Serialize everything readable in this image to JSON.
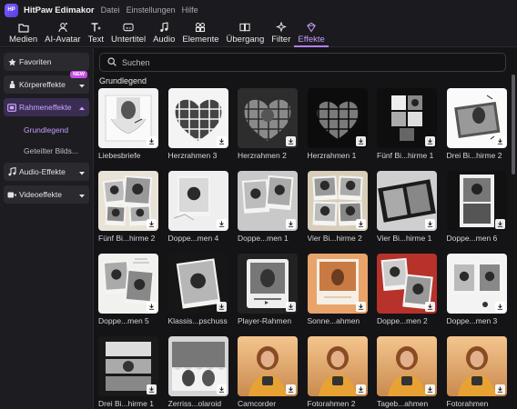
{
  "app": {
    "logo_text": "HP",
    "title": "HitPaw Edimakor",
    "menu": [
      "Datei",
      "Einstellungen",
      "Hilfe"
    ]
  },
  "toolbar": [
    {
      "label": "Medien",
      "icon": "folder-icon"
    },
    {
      "label": "AI-Avatar",
      "icon": "ai-avatar-icon"
    },
    {
      "label": "Text",
      "icon": "text-icon"
    },
    {
      "label": "Untertitel",
      "icon": "subtitle-icon"
    },
    {
      "label": "Audio",
      "icon": "music-note-icon"
    },
    {
      "label": "Elemente",
      "icon": "elements-icon"
    },
    {
      "label": "Übergang",
      "icon": "transition-icon"
    },
    {
      "label": "Filter",
      "icon": "filter-sparkle-icon"
    },
    {
      "label": "Effekte",
      "icon": "effects-icon",
      "active": true
    }
  ],
  "sidebar": {
    "items": [
      {
        "label": "Favoriten",
        "icon": "star-icon"
      },
      {
        "label": "Körpereffekte",
        "icon": "body-effects-icon",
        "badge": "NEW"
      },
      {
        "label": "Rahmeneffekte",
        "icon": "frame-icon",
        "active": true,
        "expanded": true
      },
      {
        "label": "Audio-Effekte",
        "icon": "audio-effects-icon"
      },
      {
        "label": "Videoeffekte",
        "icon": "video-effects-icon"
      }
    ],
    "subitems": [
      {
        "label": "Grundlegend",
        "active": true
      },
      {
        "label": "Geteilter Bilds..."
      }
    ]
  },
  "search": {
    "placeholder": "Suchen",
    "value": ""
  },
  "section": {
    "title": "Grundlegend"
  },
  "effects": [
    {
      "label": "Liebesbriefe",
      "style": "loveletter"
    },
    {
      "label": "Herzrahmen 3",
      "style": "heartgrid-light"
    },
    {
      "label": "Herzrahmen 2",
      "style": "heartgrid-dark"
    },
    {
      "label": "Herzrahmen 1",
      "style": "heartgrid-black"
    },
    {
      "label": "Fünf Bi...hirme 1",
      "style": "fivescreen"
    },
    {
      "label": "Drei Bi...hirme 2",
      "style": "threescreen-light"
    },
    {
      "label": "Fünf Bi...hirme 2",
      "style": "scrapbook"
    },
    {
      "label": "Doppe...men 4",
      "style": "double-light"
    },
    {
      "label": "Doppe...men 1",
      "style": "double-grey"
    },
    {
      "label": "Vier Bi...hirme 2",
      "style": "four-tan"
    },
    {
      "label": "Vier Bi...hirme 1",
      "style": "four-film"
    },
    {
      "label": "Doppe...men 6",
      "style": "filmstrip"
    },
    {
      "label": "Doppe...men 5",
      "style": "double-paper"
    },
    {
      "label": "Klassis...pschuss",
      "style": "polaroid-dark"
    },
    {
      "label": "Player-Rahmen",
      "style": "player"
    },
    {
      "label": "Sonne...ahmen",
      "style": "sunset"
    },
    {
      "label": "Doppe...men 2",
      "style": "double-red"
    },
    {
      "label": "Doppe...men 3",
      "style": "double-white"
    },
    {
      "label": "Drei Bi...hirme 1",
      "style": "three-dark"
    },
    {
      "label": "Zerriss...olaroid",
      "style": "torn"
    },
    {
      "label": "Camcorder",
      "style": "orange"
    },
    {
      "label": "Fotorahmen 2",
      "style": "orange"
    },
    {
      "label": "Tageb...ahmen",
      "style": "orange"
    },
    {
      "label": "Fotorahmen",
      "style": "orange"
    }
  ],
  "colors": {
    "accent": "#b77cff",
    "accent_bg": "#3a2d52",
    "badge": "#c84de8",
    "background": "#141417",
    "panel": "#1d1d21"
  }
}
